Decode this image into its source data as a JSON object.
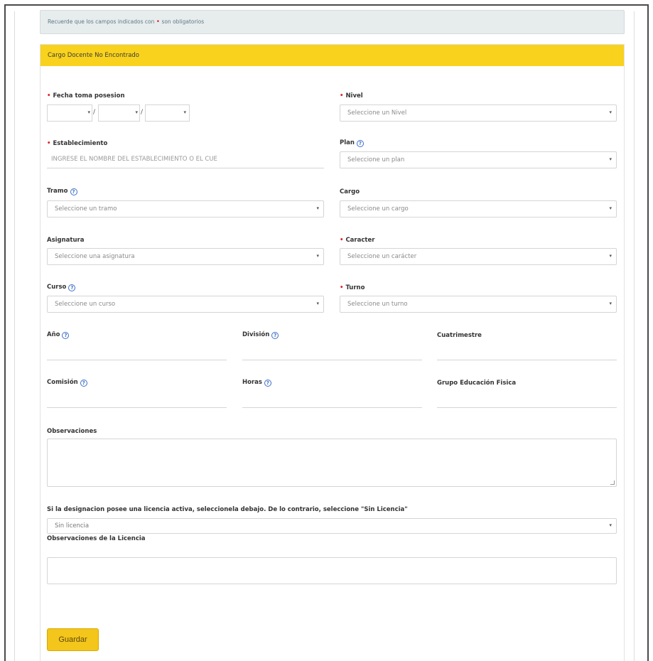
{
  "notice": {
    "text_before": "Recuerde que los campos indicados con",
    "text_after": "son obligatorios"
  },
  "card": {
    "title": "Cargo Docente No Encontrado"
  },
  "fields": {
    "fecha": {
      "label": "Fecha toma posesion"
    },
    "nivel": {
      "label": "Nivel",
      "placeholder": "Seleccione un Nivel"
    },
    "establecimiento": {
      "label": "Establecimiento",
      "placeholder": "INGRESE EL NOMBRE DEL ESTABLECIMIENTO O EL CUE"
    },
    "plan": {
      "label": "Plan",
      "placeholder": "Seleccione un plan"
    },
    "tramo": {
      "label": "Tramo",
      "placeholder": "Seleccione un tramo"
    },
    "cargo": {
      "label": "Cargo",
      "placeholder": "Seleccione un cargo"
    },
    "asignatura": {
      "label": "Asignatura",
      "placeholder": "Seleccione una asignatura"
    },
    "caracter": {
      "label": "Caracter",
      "placeholder": "Seleccione un carácter"
    },
    "curso": {
      "label": "Curso",
      "placeholder": "Seleccione un curso"
    },
    "turno": {
      "label": "Turno",
      "placeholder": "Seleccione un turno"
    },
    "anio": {
      "label": "Año"
    },
    "division": {
      "label": "División"
    },
    "cuatrimestre": {
      "label": "Cuatrimestre"
    },
    "comision": {
      "label": "Comisión"
    },
    "horas": {
      "label": "Horas"
    },
    "grupo": {
      "label": "Grupo Educación Fisica"
    },
    "observaciones": {
      "label": "Observaciones"
    },
    "licencia": {
      "label": "Si la designacion posee una licencia activa, seleccionela debajo. De lo contrario, seleccione \"Sin Licencia\"",
      "value": "Sin licencia"
    },
    "obs_licencia": {
      "label": "Observaciones de la Licencia"
    }
  },
  "glyphs": {
    "required": "•",
    "help": "?",
    "caret": "▾",
    "slash": "/"
  },
  "actions": {
    "save": "Guardar"
  },
  "colors": {
    "header": "#f8d21d",
    "required": "#d9262a",
    "help": "#3b6fc9",
    "button": "#f4c51b"
  }
}
